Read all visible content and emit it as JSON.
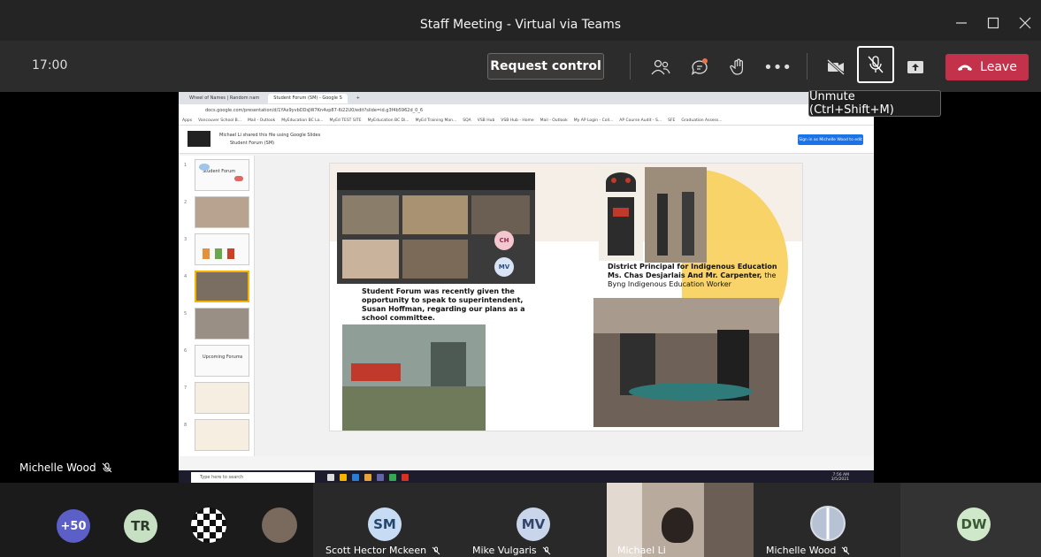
{
  "window": {
    "title": "Staff Meeting - Virtual via Teams"
  },
  "toolbar": {
    "clock": "17:00",
    "request_control": "Request control",
    "more": "•••",
    "leave": "Leave",
    "tooltip": "Unmute (Ctrl+Shift+M)"
  },
  "stage": {
    "presenter_name": "Michelle Wood"
  },
  "browser": {
    "tabs": [
      "Wheel of Names | Random nam",
      "Student Forum (SM) - Google S"
    ],
    "url": "docs.google.com/presentation/d/1YAx9yvbDDsJW7Kn4vp87-6i22U0/edit?slide=id.g3f4b5962d_0_6",
    "bookmarks": [
      "Apps",
      "Vancouver School B...",
      "Mail - Outlook",
      "MyEducation BC Lo...",
      "MyEd TEST SITE",
      "MyEducation BC Di...",
      "MyEd Training Man...",
      "SQA",
      "VSB Hub",
      "VSB Hub - Home",
      "Mail - Outlook",
      "My AP Login - Coll...",
      "AP Course Audit - S...",
      "SFE",
      "Graduation Assess..."
    ]
  },
  "slides_app": {
    "shared_by": "Michael Li shared this file using Google Slides",
    "file_name": "Student Forum (SM)",
    "sign_in": "Sign in as Michelle Wood to edit",
    "thumb_labels": [
      "Student Forum",
      "Upcoming Forums"
    ]
  },
  "slide": {
    "caption_left": "Student Forum was recently given the opportunity to speak to superintendent, Susan Hoffman, regarding our plans as a school committee.",
    "caption_right_bold": "District Principal for Indigenous Education Ms. Chas Desjarlais And Mr. Carpenter,",
    "caption_right_rest": "the Byng Indigenous Education Worker",
    "zoom_initials": [
      "CH",
      "MV"
    ]
  },
  "taskbar": {
    "search": "Type here to search",
    "time": "7:56 AM",
    "date": "3/5/2021"
  },
  "participants": [
    {
      "initials": "+50",
      "color": "#5b5fc7",
      "text": "#fff"
    },
    {
      "initials": "TR",
      "color": "#c7e0c4",
      "text": "#2b3a29"
    },
    {
      "initials": "SM",
      "color": "#c7dcf4",
      "text": "#24466b",
      "name": "Scott Hector Mckeen"
    },
    {
      "initials": "MV",
      "color": "#c9d5ea",
      "text": "#33456a",
      "name": "Mike Vulgaris"
    },
    {
      "name": "Michael Li"
    },
    {
      "name": "Michelle Wood"
    },
    {
      "initials": "DW",
      "color": "#cfe8c9",
      "text": "#3a5935"
    }
  ]
}
